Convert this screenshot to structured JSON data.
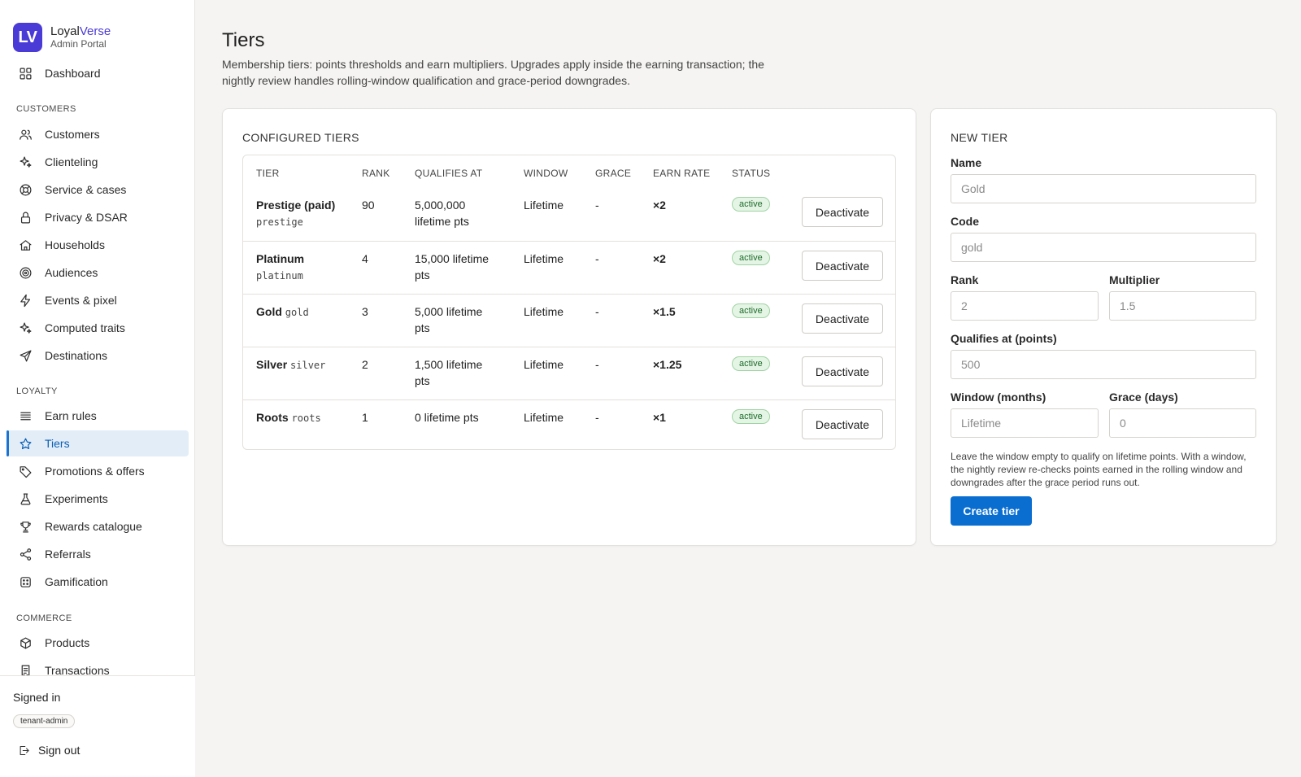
{
  "brand": {
    "logo": "LV",
    "name_part1": "Loyal",
    "name_part2": "Verse",
    "subtitle": "Admin Portal"
  },
  "sidebar": {
    "top": {
      "label": "Dashboard",
      "icon": "grid-icon"
    },
    "sections": [
      {
        "title": "CUSTOMERS",
        "items": [
          {
            "label": "Customers",
            "icon": "users-icon"
          },
          {
            "label": "Clienteling",
            "icon": "sparkle-icon"
          },
          {
            "label": "Service & cases",
            "icon": "lifebuoy-icon"
          },
          {
            "label": "Privacy & DSAR",
            "icon": "lock-icon"
          },
          {
            "label": "Households",
            "icon": "home-icon"
          },
          {
            "label": "Audiences",
            "icon": "target-icon"
          },
          {
            "label": "Events & pixel",
            "icon": "bolt-icon"
          },
          {
            "label": "Computed traits",
            "icon": "sparkle-icon"
          },
          {
            "label": "Destinations",
            "icon": "send-icon"
          }
        ]
      },
      {
        "title": "LOYALTY",
        "items": [
          {
            "label": "Earn rules",
            "icon": "list-icon"
          },
          {
            "label": "Tiers",
            "icon": "star-icon",
            "active": true
          },
          {
            "label": "Promotions & offers",
            "icon": "tag-icon"
          },
          {
            "label": "Experiments",
            "icon": "flask-icon"
          },
          {
            "label": "Rewards catalogue",
            "icon": "trophy-icon"
          },
          {
            "label": "Referrals",
            "icon": "share-icon"
          },
          {
            "label": "Gamification",
            "icon": "dice-icon"
          }
        ]
      },
      {
        "title": "COMMERCE",
        "items": [
          {
            "label": "Products",
            "icon": "box-icon"
          },
          {
            "label": "Transactions",
            "icon": "receipt-icon"
          }
        ]
      }
    ],
    "signed_in_label": "Signed in",
    "role": "tenant-admin",
    "sign_out": "Sign out"
  },
  "page": {
    "title": "Tiers",
    "description": "Membership tiers: points thresholds and earn multipliers. Upgrades apply inside the earning transaction; the nightly review handles rolling-window qualification and grace-period downgrades."
  },
  "tiers_card": {
    "heading": "CONFIGURED TIERS",
    "columns": [
      "TIER",
      "RANK",
      "QUALIFIES AT",
      "WINDOW",
      "GRACE",
      "EARN RATE",
      "STATUS"
    ],
    "rows": [
      {
        "name": "Prestige (paid)",
        "code": "prestige",
        "code_newline": true,
        "rank": "90",
        "qualifies": "5,000,000 lifetime pts",
        "window": "Lifetime",
        "grace": "-",
        "earn": "×2",
        "status": "active",
        "action": "Deactivate"
      },
      {
        "name": "Platinum",
        "code": "platinum",
        "code_newline": true,
        "rank": "4",
        "qualifies": "15,000 lifetime pts",
        "window": "Lifetime",
        "grace": "-",
        "earn": "×2",
        "status": "active",
        "action": "Deactivate"
      },
      {
        "name": "Gold",
        "code": "gold",
        "code_newline": false,
        "rank": "3",
        "qualifies": "5,000 lifetime pts",
        "window": "Lifetime",
        "grace": "-",
        "earn": "×1.5",
        "status": "active",
        "action": "Deactivate"
      },
      {
        "name": "Silver",
        "code": "silver",
        "code_newline": false,
        "rank": "2",
        "qualifies": "1,500 lifetime pts",
        "window": "Lifetime",
        "grace": "-",
        "earn": "×1.25",
        "status": "active",
        "action": "Deactivate"
      },
      {
        "name": "Roots",
        "code": "roots",
        "code_newline": false,
        "rank": "1",
        "qualifies": "0 lifetime pts",
        "window": "Lifetime",
        "grace": "-",
        "earn": "×1",
        "status": "active",
        "action": "Deactivate"
      }
    ]
  },
  "new_tier": {
    "heading": "NEW TIER",
    "name_label": "Name",
    "name_placeholder": "Gold",
    "name_value": "",
    "code_label": "Code",
    "code_placeholder": "gold",
    "code_value": "",
    "rank_label": "Rank",
    "rank_placeholder": "2",
    "rank_value": "",
    "multiplier_label": "Multiplier",
    "multiplier_placeholder": "1.5",
    "multiplier_value": "",
    "qualifies_label": "Qualifies at (points)",
    "qualifies_placeholder": "500",
    "qualifies_value": "",
    "window_label": "Window (months)",
    "window_placeholder": "Lifetime",
    "window_value": "",
    "grace_label": "Grace (days)",
    "grace_placeholder": "0",
    "grace_value": "",
    "hint": "Leave the window empty to qualify on lifetime points. With a window, the nightly review re-checks points earned in the rolling window and downgrades after the grace period runs out.",
    "submit": "Create tier"
  },
  "colors": {
    "brand": "#4b3bd6",
    "primary": "#0a6ed1",
    "active_nav_bg": "#e3edf8",
    "badge_green": "#1c6b2a",
    "page_bg": "#f5f4f2"
  }
}
